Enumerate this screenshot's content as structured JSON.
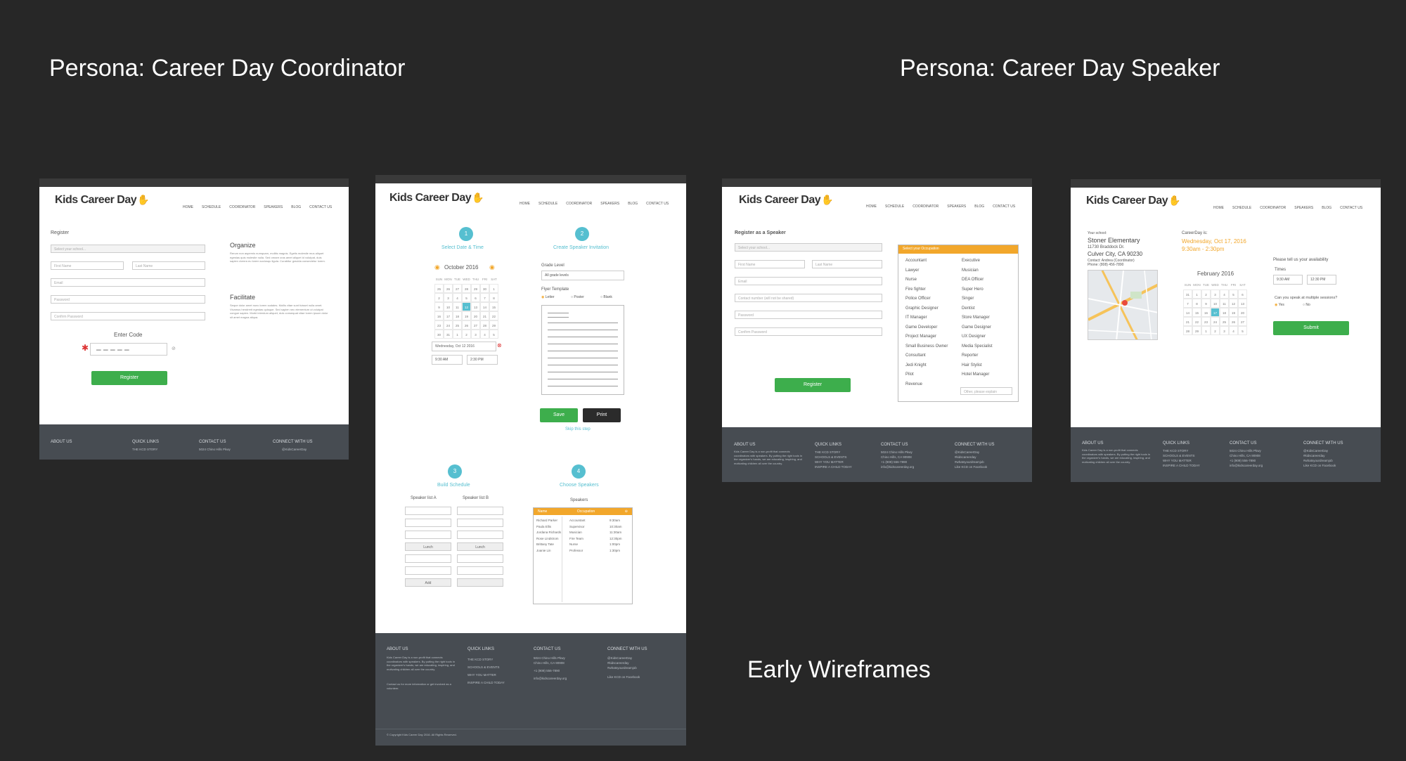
{
  "headings": {
    "coordinator": "Persona: Career Day Coordinator",
    "speaker": "Persona: Career Day Speaker",
    "early": "Early Wireframes"
  },
  "logo": "Kids Career Day",
  "nav": [
    "HOME",
    "SCHEDULE",
    "COORDINATOR",
    "SPEAKERS",
    "BLOG",
    "CONTACT US"
  ],
  "footer": {
    "about": "ABOUT US",
    "quick": "QUICK LINKS",
    "contact": "CONTACT US",
    "connect": "CONNECT WITH US",
    "about_text": "Kids Career Day is a non-profit that connects coordinators with speakers. By putting the right tools in the organizer's hands, we are educating, inspiring, and motivating children all over the country.",
    "about_text2": "Contact us for more information or get involved as a volunteer.",
    "links": [
      "THE KCD STORY",
      "SCHOOLS & EVENTS",
      "WHY YOU MATTER",
      "INSPIRE A CHILD TODAY"
    ],
    "address1": "5024 Chino Hills Pkwy",
    "address2": "Chino Hills, CA 90908",
    "phone": "+1 (909) 556-7890",
    "email": "info@kidscareerday.org",
    "twitter1": "@KidsCareerDay",
    "twitter2": "#kidscareerday",
    "twitter3": "#whatsyourdreamjob",
    "linkedin": "Like KCD on Facebook",
    "copyright": "© Copyright Kids Career Day 2016. All Rights Reserved."
  },
  "frame1": {
    "register": "Register",
    "school_placeholder": "Select your school...",
    "first": "First Name",
    "last": "Last Name",
    "email": "Email",
    "password": "Password",
    "confirm": "Confirm Password",
    "enter_code": "Enter Code",
    "code": "– – – – –",
    "register_btn": "Register",
    "organize": "Organize",
    "organize_text": "Rerum non aspernis numquam, molitis magnis. Egetis molestie mus aliquet egestas quis molestie nulla. Sed ornare cras amet aliquet id volutpat, duis sapien viverra eu lorem sociosqu ligula. Curabitur gravida consectetur lorem.",
    "facilitate": "Facilitate",
    "facilitate_text": "Seque dolor amet nunc lorem sodales. Mollis vitae sunt fuisset nulla amet. Vivamus hendrerit egestas quisque. Sed sapien nec elementum ut volutpat congue sapien. Morbi interdum aliquet, duis consequat vitae lorem ipsum dolor sit amet magna aliqua."
  },
  "frame2": {
    "step1": "1",
    "step1_title": "Select Date & Time",
    "step2": "2",
    "step2_title": "Create Speaker Invitation",
    "month": "October 2016",
    "days": [
      "SUN",
      "MON",
      "TUE",
      "WED",
      "THU",
      "FRI",
      "SAT"
    ],
    "dates": [
      "25",
      "26",
      "27",
      "28",
      "29",
      "30",
      "1",
      "2",
      "3",
      "4",
      "5",
      "6",
      "7",
      "8",
      "9",
      "10",
      "11",
      "12",
      "13",
      "14",
      "15",
      "16",
      "17",
      "18",
      "19",
      "20",
      "21",
      "22",
      "23",
      "24",
      "25",
      "26",
      "27",
      "28",
      "29",
      "30",
      "31",
      "1",
      "2",
      "3",
      "4",
      "5"
    ],
    "selected_date": "Wednesday, Oct 12 2016",
    "start": "9:30 AM",
    "end": "2:30 PM",
    "grade_label": "Grade Level",
    "grade_value": "All grade levels",
    "flyer_label": "Flyer Template",
    "flyer_options": [
      "Letter",
      "Poster",
      "Blank"
    ],
    "save": "Save",
    "print": "Print",
    "skip": "Skip this step",
    "step3": "3",
    "step3_title": "Build Schedule",
    "step4": "4",
    "step4_title": "Choose Speakers",
    "list_a": "Speaker list A",
    "list_b": "Speaker list B",
    "lunch": "Lunch",
    "add": "Add",
    "speakers_label": "Speakers",
    "speaker_cols": [
      "Name",
      "Occupation"
    ],
    "speaker_rows": [
      [
        "Richard Parker",
        "Accountant",
        "9:30am"
      ],
      [
        "Paula Ellis",
        "Supervisor",
        "10:30am"
      ],
      [
        "Jordana Richards",
        "Musician",
        "11:30am"
      ],
      [
        "Rose Lindstrom",
        "Fire Team",
        "12:30pm"
      ],
      [
        "Brittany Tate",
        "Nurse",
        "1:00pm"
      ],
      [
        "Joanie Lin",
        "Professor",
        "1:30pm"
      ]
    ]
  },
  "frame3": {
    "title": "Register as a Speaker",
    "school_placeholder": "Select your school...",
    "first": "First Name",
    "last": "Last Name",
    "email": "Email",
    "contact": "Contact number (will not be shared)",
    "password": "Password",
    "confirm": "Confirm Password",
    "register_btn": "Register",
    "occupation_bar": "Select your Occupation",
    "occupations_left": [
      "Accountant",
      "Lawyer",
      "Nurse",
      "Fire fighter",
      "Police Officer",
      "Graphic Designer",
      "IT Manager",
      "Game Developer",
      "Project Manager",
      "Small Business Owner",
      "Consultant",
      "Jedi Knight",
      "Pilot",
      "Revenue"
    ],
    "occupations_right": [
      "Executive",
      "Musician",
      "DEA Officer",
      "Super Hero",
      "Singer",
      "Dentist",
      "Store Manager",
      "Game Designer",
      "UX Designer",
      "Media Specialist",
      "Reporter",
      "Hair Stylist",
      "Hotel Manager"
    ],
    "other_placeholder": "Other, please explain"
  },
  "frame4": {
    "your_school": "Your school:",
    "school_name": "Stoner Elementary",
    "addr1": "11730 Braddock Dr.",
    "addr2": "Culver City, CA 90230",
    "contact": "Contact: Andrea (Coordinator)",
    "phone": "Phone: (808) 456-7890",
    "careerday_is": "CareerDay is:",
    "date": "Wednesday, Oct 17, 2016",
    "time": "9:30am - 2:30pm",
    "month": "February 2016",
    "days": [
      "SUN",
      "MON",
      "TUE",
      "WED",
      "THU",
      "FRI",
      "SAT"
    ],
    "dates": [
      "31",
      "1",
      "2",
      "3",
      "4",
      "5",
      "6",
      "7",
      "8",
      "9",
      "10",
      "11",
      "12",
      "13",
      "14",
      "15",
      "16",
      "17",
      "18",
      "19",
      "20",
      "21",
      "22",
      "23",
      "24",
      "25",
      "26",
      "27",
      "28",
      "29",
      "1",
      "2",
      "3",
      "4",
      "5"
    ],
    "availability": "Please tell us your availability",
    "times": "Times",
    "start": "9:30 AM",
    "end": "12:30 PM",
    "multiple": "Can you speak at multiple sessions?",
    "yes": "Yes",
    "no": "No",
    "submit": "Submit"
  },
  "colors": {
    "accent": "#56bfd0",
    "green": "#3dae4c",
    "orange": "#f2a72b",
    "footer": "#474c52",
    "background": "#272727"
  }
}
